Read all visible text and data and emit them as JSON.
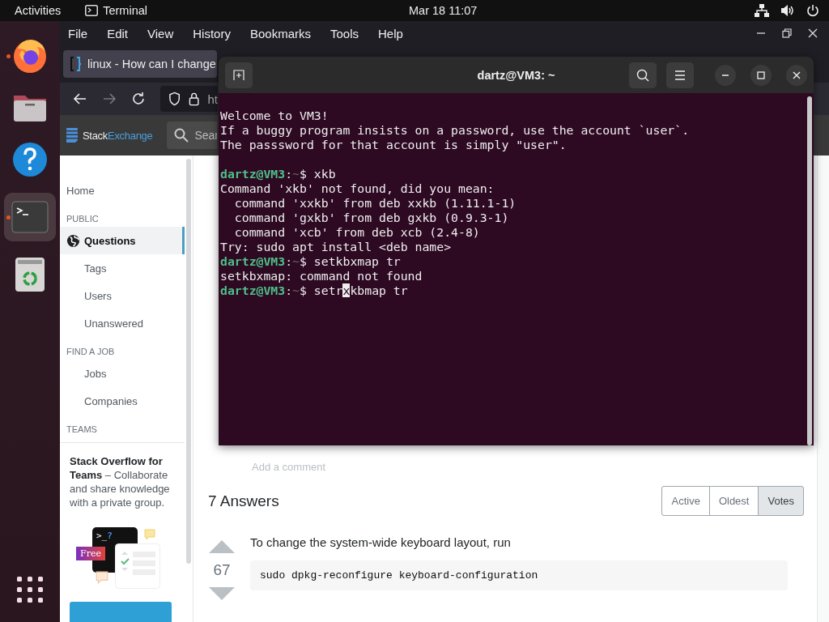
{
  "top_bar": {
    "activities": "Activities",
    "app_name": "Terminal",
    "clock": "Mar 18  11:07"
  },
  "dock": [
    {
      "kind": "firefox",
      "running": true,
      "selected": false
    },
    {
      "kind": "files",
      "running": false,
      "selected": false
    },
    {
      "kind": "help",
      "running": false,
      "selected": false
    },
    {
      "kind": "terminal",
      "running": true,
      "selected": true
    },
    {
      "kind": "trash",
      "running": false,
      "selected": false
    }
  ],
  "browser": {
    "menu": [
      "File",
      "Edit",
      "View",
      "History",
      "Bookmarks",
      "Tools",
      "Help"
    ],
    "tab": {
      "title": "linux - How can I change"
    },
    "url": "ht",
    "site_header": {
      "logo_a": "Stack",
      "logo_b": "Exchange",
      "search_placeholder": "Sear"
    },
    "sidebar": [
      {
        "kind": "link",
        "label": "Home",
        "selected": false
      },
      {
        "kind": "heading",
        "label": "PUBLIC"
      },
      {
        "kind": "link",
        "label": "Questions",
        "selected": true,
        "icon": true
      },
      {
        "kind": "sublink",
        "label": "Tags",
        "selected": false
      },
      {
        "kind": "sublink",
        "label": "Users",
        "selected": false
      },
      {
        "kind": "sublink",
        "label": "Unanswered",
        "selected": false
      },
      {
        "kind": "heading",
        "label": "FIND A JOB"
      },
      {
        "kind": "sublink",
        "label": "Jobs",
        "selected": false
      },
      {
        "kind": "sublink",
        "label": "Companies",
        "selected": false
      },
      {
        "kind": "heading",
        "label": "TEAMS"
      }
    ],
    "teams_promo": {
      "text": "**Stack Overflow for Teams** – Collaborate and share knowledge with a private group.",
      "art_prompt": ">_",
      "art_mark": "?",
      "badge": "Free"
    },
    "add_comment": "Add a comment",
    "answers_heading": "7 Answers",
    "sort_tabs": [
      {
        "label": "Active",
        "selected": false
      },
      {
        "label": "Oldest",
        "selected": false
      },
      {
        "label": "Votes",
        "selected": true
      }
    ],
    "answer": {
      "votes": "67",
      "text": "To change the system-wide keyboard layout, run",
      "code": "sudo dpkg-reconfigure keyboard-configuration"
    }
  },
  "terminal": {
    "title": "dartz@VM3: ~",
    "lines": [
      {
        "kind": "output",
        "text": "Welcome to VM3!"
      },
      {
        "kind": "output",
        "text": "If a buggy program insists on a password, use the account `user`."
      },
      {
        "kind": "output",
        "text": "The passsword for that account is simply \"user\"."
      },
      {
        "kind": "blank"
      },
      {
        "kind": "prompt",
        "user": "dartz@VM3",
        "sep": ":",
        "path": "~",
        "sigil": "$",
        "command": "xkb"
      },
      {
        "kind": "output",
        "text": "Command 'xkb' not found, did you mean:"
      },
      {
        "kind": "output",
        "text": "  command 'xxkb' from deb xxkb (1.11.1-1)"
      },
      {
        "kind": "output",
        "text": "  command 'gxkb' from deb gxkb (0.9.3-1)"
      },
      {
        "kind": "output",
        "text": "  command 'xcb' from deb xcb (2.4-8)"
      },
      {
        "kind": "output",
        "text": "Try: sudo apt install <deb name>"
      },
      {
        "kind": "prompt",
        "user": "dartz@VM3",
        "sep": ":",
        "path": "~",
        "sigil": "$",
        "command": "setkbxmap tr"
      },
      {
        "kind": "output",
        "text": "setkbxmap: command not found"
      },
      {
        "kind": "prompt",
        "user": "dartz@VM3",
        "sep": ":",
        "path": "~",
        "sigil": "$",
        "command": "setr",
        "cursor": "x",
        "after_cursor": "kbmap tr"
      }
    ]
  }
}
